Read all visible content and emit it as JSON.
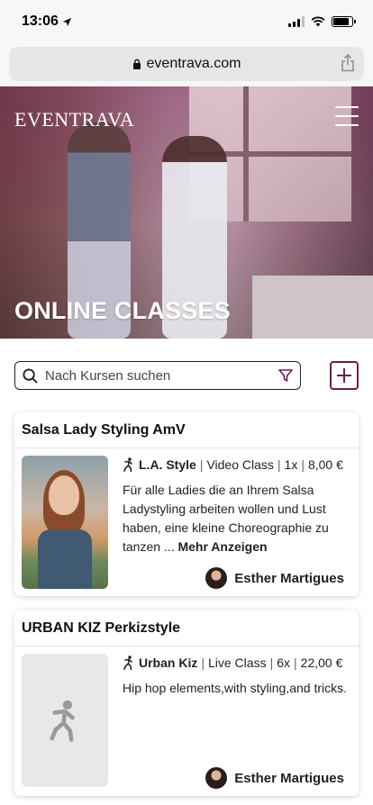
{
  "statusbar": {
    "time": "13:06"
  },
  "browser": {
    "url": "eventrava.com"
  },
  "header": {
    "brand": "EVENTRAVA",
    "hero_title": "ONLINE CLASSES"
  },
  "search": {
    "placeholder": "Nach Kursen suchen"
  },
  "classes": [
    {
      "title": "Salsa Lady Styling AmV",
      "style": "L.A. Style",
      "type": "Video Class",
      "count": "1x",
      "price": "8,00 €",
      "description": "Für alle Ladies die an Ihrem Salsa Ladystyling arbeiten wollen und Lust haben, eine kleine Choreographie zu tanzen ...",
      "more_label": "Mehr Anzeigen",
      "teacher": "Esther Martigues"
    },
    {
      "title": "URBAN KIZ Perkizstyle",
      "style": "Urban Kiz",
      "type": "Live Class",
      "count": "6x",
      "price": "22,00 €",
      "description": "Hip hop elements,with styling,and tricks.",
      "teacher": "Esther Martigues"
    }
  ],
  "colors": {
    "accent": "#6d1d55",
    "hero_overlay": "#7a2a5e"
  }
}
